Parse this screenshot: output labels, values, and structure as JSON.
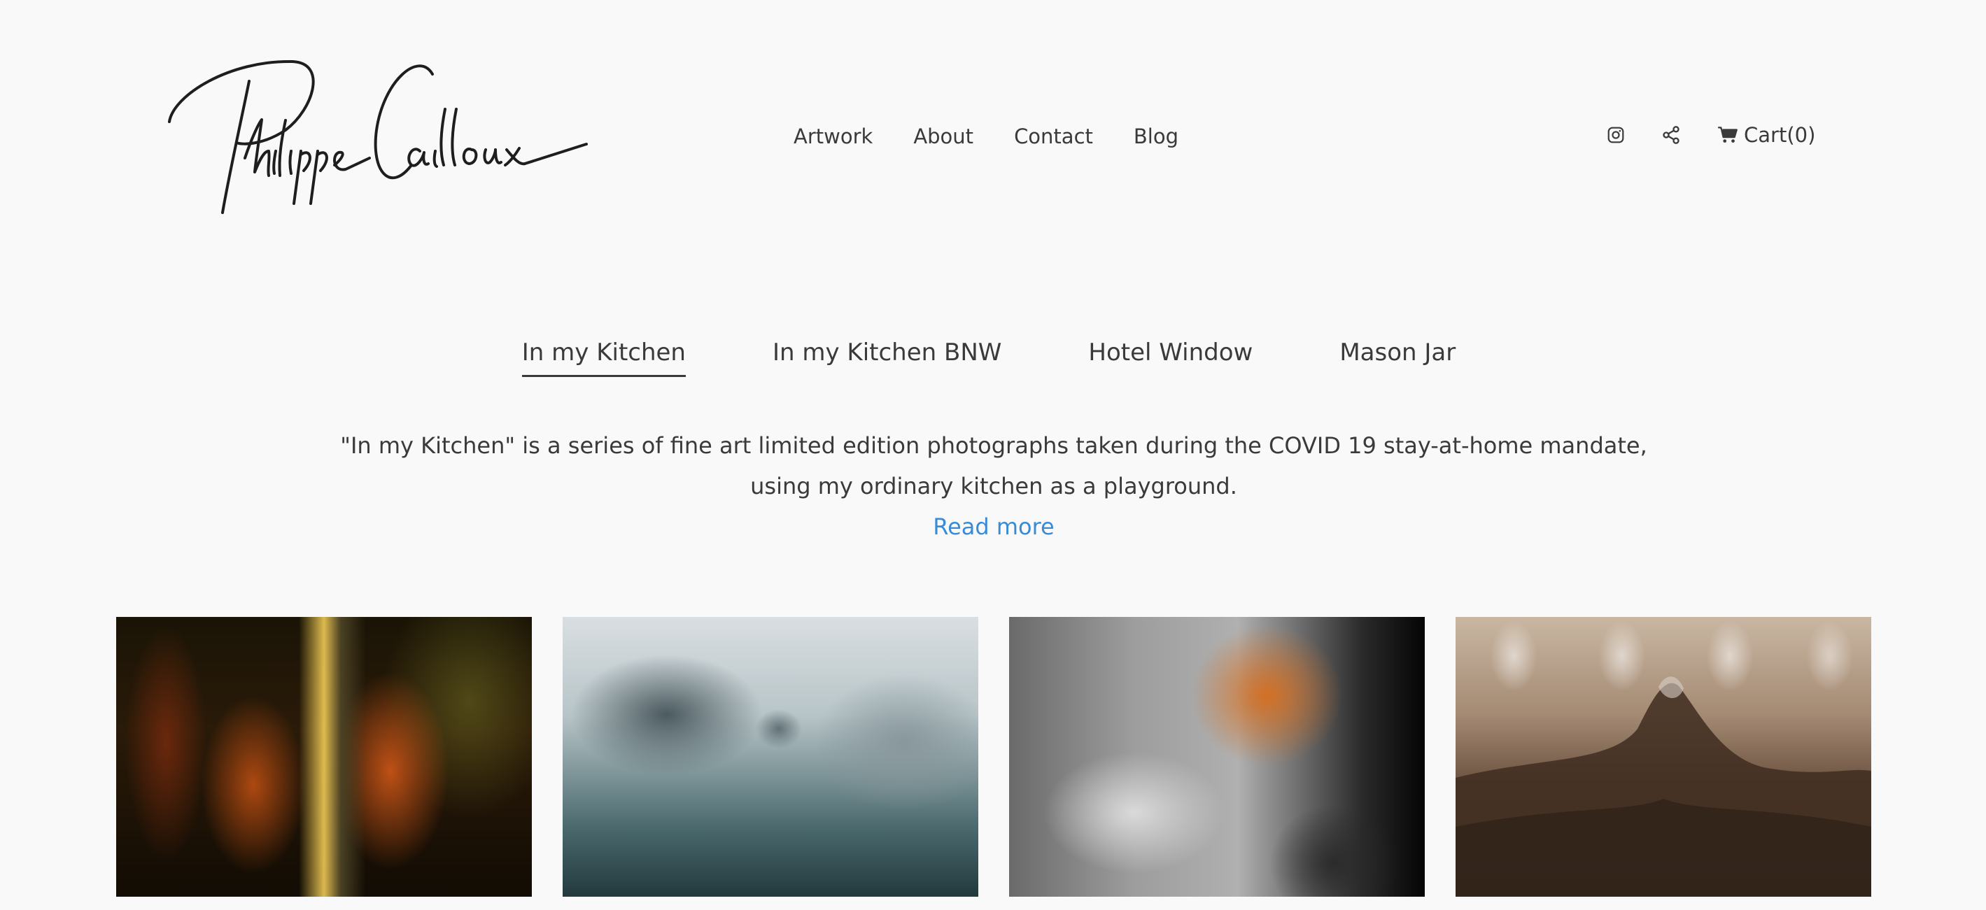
{
  "brand": {
    "logo_text": "Philippe Cailloux"
  },
  "nav": {
    "items": [
      {
        "label": "Artwork"
      },
      {
        "label": "About"
      },
      {
        "label": "Contact"
      },
      {
        "label": "Blog"
      }
    ]
  },
  "utility": {
    "instagram_icon": "instagram-icon",
    "share_icon": "share-icon",
    "cart_icon": "cart-icon",
    "cart_label": "Cart(0)"
  },
  "tabs": [
    {
      "label": "In my Kitchen",
      "active": true
    },
    {
      "label": "In my Kitchen BNW",
      "active": false
    },
    {
      "label": "Hotel Window",
      "active": false
    },
    {
      "label": "Mason Jar",
      "active": false
    }
  ],
  "description": {
    "text": "\"In my Kitchen\" is a series of fine art limited edition photographs taken during the COVID 19 stay-at-home mandate, using my ordinary kitchen as a playground.",
    "read_more": "Read more"
  },
  "colors": {
    "background": "#f9f9f9",
    "text": "#3a3a3a",
    "link": "#3a8bd6"
  }
}
